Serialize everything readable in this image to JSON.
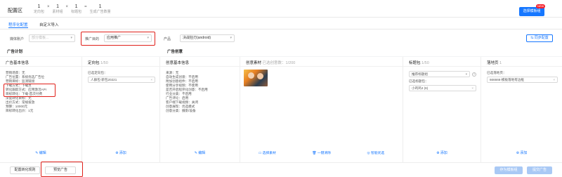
{
  "header": {
    "area_title": "配置区",
    "formula": [
      {
        "num": "1",
        "label": "定向包"
      },
      {
        "op": "×"
      },
      {
        "num": "1",
        "label": "素材组"
      },
      {
        "op": "×"
      },
      {
        "num": "1",
        "label": "标题包"
      },
      {
        "op": "="
      },
      {
        "num": "1",
        "label": "生成广告数量"
      }
    ],
    "primary_button": "选择模板组",
    "badge": "NEW"
  },
  "tabs": [
    {
      "label": "程序化配置",
      "active": true
    },
    {
      "label": "自定义导入",
      "active": false
    }
  ],
  "filters": {
    "media_account_label": "媒体账户",
    "media_account_placeholder": "部分模板...",
    "promotion_goal_label": "推广目的",
    "promotion_goal_value": "应用推广",
    "product_label": "产品",
    "product_value": "决战狂刃(android)",
    "reset_button": "同步配置"
  },
  "sections": {
    "ad_plan": "广告计划",
    "ad_creative": "广告创意"
  },
  "columns": {
    "basic_info": {
      "title": "广告基本信息",
      "lines": [
        "营销场景：无",
        "广告位置：系统优选广告位",
        "营销目标：监测链接",
        "下载方式：下载页",
        "转化跟踪方式：应用激活API",
        "目标转化：下载-首次付费",
        "深度转化目标：无",
        "出价方式：常规投放",
        "预算：10000元",
        "目标转化出价：1元"
      ],
      "edit": "编辑"
    },
    "targeting": {
      "title": "定向包",
      "count": "1/50",
      "selected_label": "已选定向包：",
      "selected_value": "人群包-新包20221",
      "add": "添加"
    },
    "creative_basic": {
      "title": "创意基本信息",
      "lines": [
        "来源：无",
        "自动生成创意：不启用",
        "附加创意组件：不启用",
        "使用分享视频：不使用",
        "是否开启程序化创意：不启用",
        "行业分类：不启用",
        "广告评论：启用",
        "客户端下载视频：关闭",
        "创意展现：优选模式",
        "创意分类：摄影/设备"
      ],
      "edit": "编辑"
    },
    "materials": {
      "title": "创意素材",
      "count": "已选创意数：1/200",
      "select": "选择素材",
      "clear": "一键清除",
      "smart": "智能优选"
    },
    "titles": {
      "title": "标题包",
      "count": "1/50",
      "select_value": "推荐标题组",
      "selected_label": "已选标题包：",
      "selected_value": "小鸡鸡4 (6)",
      "add": "添加"
    },
    "landing": {
      "title": "落地页",
      "count": "1",
      "selected_label": "已选落地页：",
      "selected_value": "666666-模板落地有边框",
      "add": "添加"
    }
  },
  "bottom": {
    "rule_button": "配置转化规则",
    "preview_button": "预览广告",
    "save_template": "存为模板组",
    "submit": "提交广告"
  },
  "colors": {
    "primary": "#1677ff",
    "highlight_box": "#e0201a"
  }
}
